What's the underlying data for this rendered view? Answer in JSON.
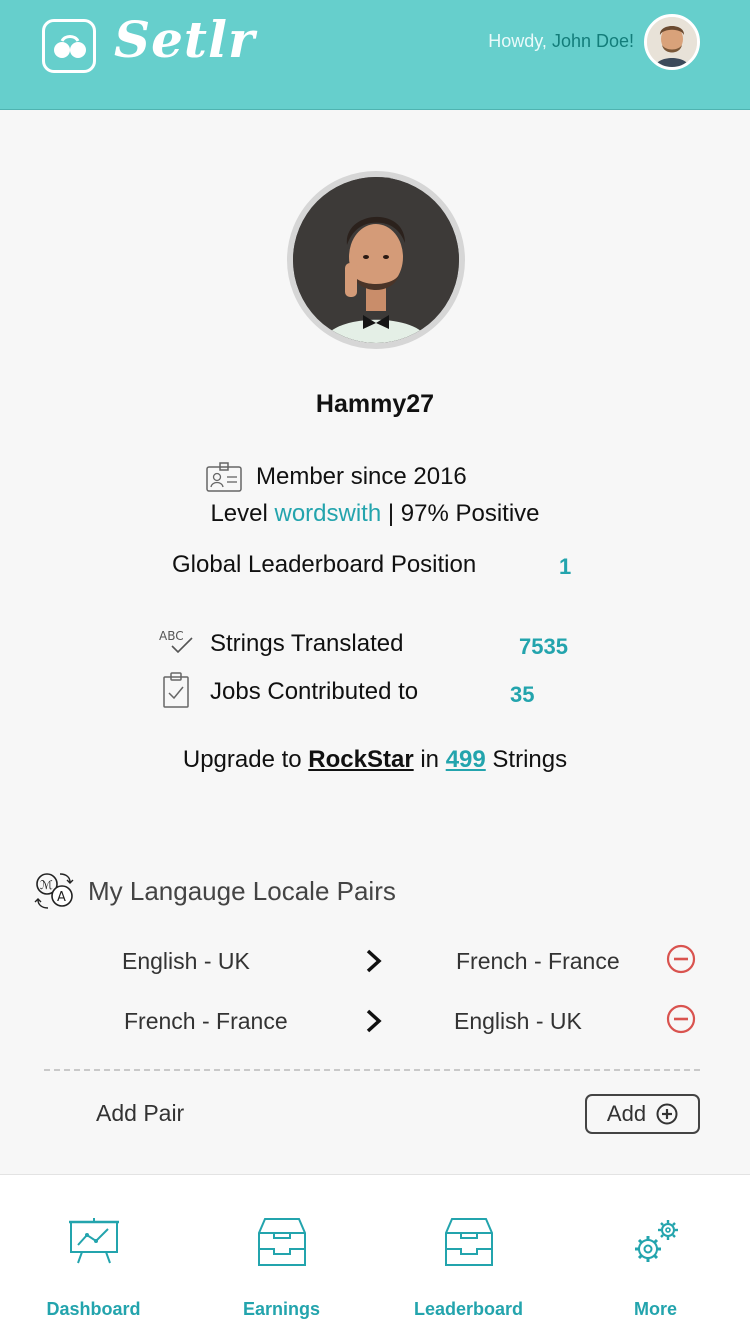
{
  "header": {
    "brand": "Setlr",
    "greeting": "Howdy,",
    "user_name": "John Doe!"
  },
  "profile": {
    "username": "Hammy27",
    "member_since": "Member since 2016",
    "level_prefix": "Level",
    "level_name": "wordswith",
    "level_sep": "|",
    "feedback": "97% Positive",
    "leaderboard_label": "Global Leaderboard Position",
    "leaderboard_value": "1",
    "strings_label": "Strings Translated",
    "strings_value": "7535",
    "jobs_label": "Jobs Contributed to",
    "jobs_value": "35",
    "upgrade_prefix": "Upgrade to",
    "upgrade_tier": "RockStar",
    "upgrade_mid": "in",
    "upgrade_count": "499",
    "upgrade_suffix": "Strings"
  },
  "pairs": {
    "title": "My Langauge Locale Pairs",
    "items": [
      {
        "from": "English - UK",
        "to": "French - France"
      },
      {
        "from": "French - France",
        "to": "English - UK"
      }
    ],
    "add_label": "Add Pair",
    "add_button": "Add"
  },
  "nav": {
    "items": [
      {
        "label": "Dashboard",
        "icon": "dashboard-chart-icon"
      },
      {
        "label": "Earnings",
        "icon": "inbox-tray-icon"
      },
      {
        "label": "Leaderboard",
        "icon": "inbox-tray-icon"
      },
      {
        "label": "More",
        "icon": "gears-icon"
      }
    ]
  },
  "colors": {
    "header_bg": "#66cfcc",
    "accent": "#23a4ad",
    "remove": "#d9534f"
  }
}
